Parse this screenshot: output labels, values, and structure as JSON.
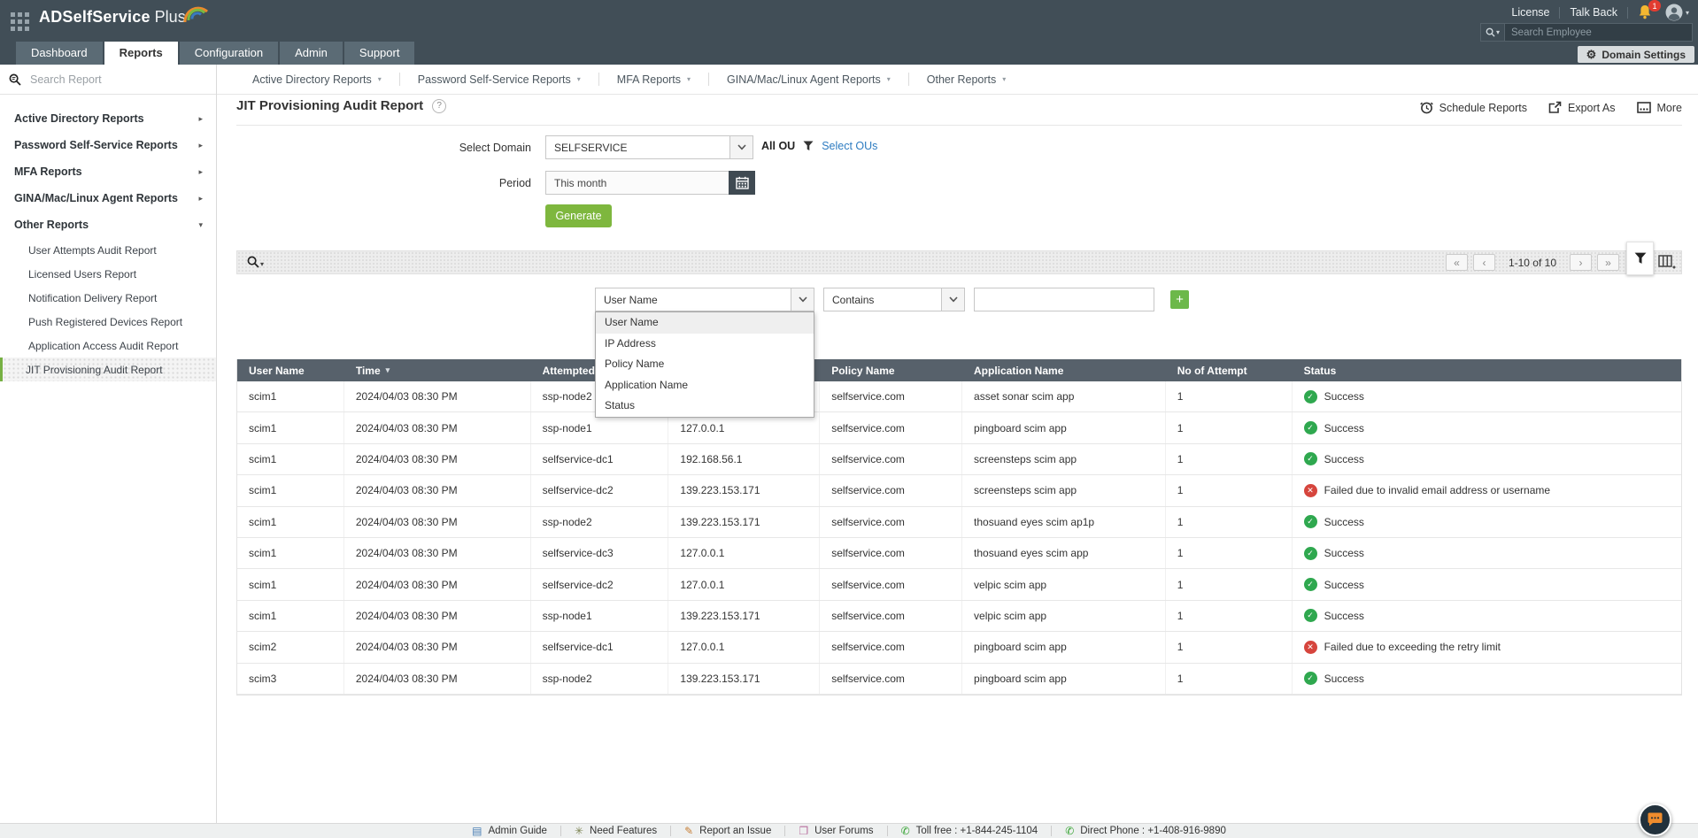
{
  "header": {
    "brand": {
      "name_bold": "ADSelfService",
      "name_light": "Plus"
    },
    "utilities": {
      "license": "License",
      "talk_back": "Talk Back",
      "notification_count": "1"
    },
    "employee_search_placeholder": "Search Employee",
    "domain_settings_label": "Domain Settings",
    "tabs": [
      {
        "label": "Dashboard",
        "active": false
      },
      {
        "label": "Reports",
        "active": true
      },
      {
        "label": "Configuration",
        "active": false
      },
      {
        "label": "Admin",
        "active": false
      },
      {
        "label": "Support",
        "active": false
      }
    ]
  },
  "reports_nav": {
    "items": [
      "Active Directory Reports",
      "Password Self-Service Reports",
      "MFA Reports",
      "GINA/Mac/Linux Agent Reports",
      "Other Reports"
    ]
  },
  "sidebar": {
    "search_placeholder": "Search Report",
    "top_items": [
      {
        "label": "Active Directory Reports",
        "expanded": false
      },
      {
        "label": "Password Self-Service Reports",
        "expanded": false
      },
      {
        "label": "MFA Reports",
        "expanded": false
      },
      {
        "label": "GINA/Mac/Linux Agent Reports",
        "expanded": false
      },
      {
        "label": "Other Reports",
        "expanded": true
      }
    ],
    "other_reports_items": [
      "User Attempts Audit Report",
      "Licensed Users Report",
      "Notification Delivery Report",
      "Push Registered Devices Report",
      "Application Access Audit Report",
      "JIT Provisioning Audit Report"
    ],
    "selected_item": "JIT Provisioning Audit Report"
  },
  "page": {
    "title": "JIT Provisioning Audit Report",
    "actions": {
      "schedule": "Schedule Reports",
      "export": "Export As",
      "more": "More"
    },
    "form": {
      "select_domain_label": "Select Domain",
      "domain_value": "SELFSERVICE",
      "all_ou_label": "All OU",
      "select_ous_label": "Select OUs",
      "period_label": "Period",
      "period_value": "This month",
      "generate_label": "Generate"
    },
    "toolbar": {
      "pagination_text": "1-10 of 10"
    },
    "filter": {
      "field_value": "User Name",
      "operator_value": "Contains",
      "input_value": "",
      "field_options": [
        "User Name",
        "IP Address",
        "Policy Name",
        "Application Name",
        "Status"
      ]
    },
    "table": {
      "columns": [
        "User Name",
        "Time",
        "Attempted",
        "",
        "Policy Name",
        "Application Name",
        "No of Attempt",
        "Status"
      ],
      "sort_column": "Time",
      "rows": [
        {
          "user_name": "scim1",
          "time": "2024/04/03 08:30 PM",
          "attempted_node": "ssp-node2",
          "ip_address": "",
          "policy_name": "selfservice.com",
          "application_name": "asset sonar scim app",
          "no_of_attempt": "1",
          "status": "Success",
          "status_ok": true
        },
        {
          "user_name": "scim1",
          "time": "2024/04/03 08:30 PM",
          "attempted_node": "ssp-node1",
          "ip_address": "127.0.0.1",
          "policy_name": "selfservice.com",
          "application_name": "pingboard scim app",
          "no_of_attempt": "1",
          "status": "Success",
          "status_ok": true
        },
        {
          "user_name": "scim1",
          "time": "2024/04/03 08:30 PM",
          "attempted_node": "selfservice-dc1",
          "ip_address": "192.168.56.1",
          "policy_name": "selfservice.com",
          "application_name": "screensteps scim app",
          "no_of_attempt": "1",
          "status": "Success",
          "status_ok": true
        },
        {
          "user_name": "scim1",
          "time": "2024/04/03 08:30 PM",
          "attempted_node": "selfservice-dc2",
          "ip_address": "139.223.153.171",
          "policy_name": "selfservice.com",
          "application_name": "screensteps scim app",
          "no_of_attempt": "1",
          "status": "Failed due to invalid email address or username",
          "status_ok": false
        },
        {
          "user_name": "scim1",
          "time": "2024/04/03 08:30 PM",
          "attempted_node": "ssp-node2",
          "ip_address": "139.223.153.171",
          "policy_name": "selfservice.com",
          "application_name": "thosuand eyes scim ap1p",
          "no_of_attempt": "1",
          "status": "Success",
          "status_ok": true
        },
        {
          "user_name": "scim1",
          "time": "2024/04/03 08:30 PM",
          "attempted_node": "selfservice-dc3",
          "ip_address": "127.0.0.1",
          "policy_name": "selfservice.com",
          "application_name": "thosuand eyes scim app",
          "no_of_attempt": "1",
          "status": "Success",
          "status_ok": true
        },
        {
          "user_name": "scim1",
          "time": "2024/04/03 08:30 PM",
          "attempted_node": "selfservice-dc2",
          "ip_address": "127.0.0.1",
          "policy_name": "selfservice.com",
          "application_name": "velpic scim app",
          "no_of_attempt": "1",
          "status": "Success",
          "status_ok": true
        },
        {
          "user_name": "scim1",
          "time": "2024/04/03 08:30 PM",
          "attempted_node": "ssp-node1",
          "ip_address": "139.223.153.171",
          "policy_name": "selfservice.com",
          "application_name": "velpic scim app",
          "no_of_attempt": "1",
          "status": "Success",
          "status_ok": true
        },
        {
          "user_name": "scim2",
          "time": "2024/04/03 08:30 PM",
          "attempted_node": "selfservice-dc1",
          "ip_address": "127.0.0.1",
          "policy_name": "selfservice.com",
          "application_name": "pingboard scim app",
          "no_of_attempt": "1",
          "status": "Failed due to exceeding the retry limit",
          "status_ok": false
        },
        {
          "user_name": "scim3",
          "time": "2024/04/03 08:30 PM",
          "attempted_node": "ssp-node2",
          "ip_address": "139.223.153.171",
          "policy_name": "selfservice.com",
          "application_name": "pingboard scim app",
          "no_of_attempt": "1",
          "status": "Success",
          "status_ok": true
        }
      ]
    }
  },
  "footer": {
    "items": [
      {
        "icon": "book",
        "label": "Admin Guide"
      },
      {
        "icon": "features",
        "label": "Need Features"
      },
      {
        "icon": "report",
        "label": "Report an Issue"
      },
      {
        "icon": "forums",
        "label": "User Forums"
      },
      {
        "icon": "phone",
        "label": "Toll free : +1-844-245-1104"
      },
      {
        "icon": "phone",
        "label": "Direct Phone : +1-408-916-9890"
      }
    ]
  },
  "colors": {
    "header_bg": "#414e57",
    "accent_green": "#7eb73e",
    "link_blue": "#2e7cc1",
    "table_header_bg": "#57616b",
    "success_green": "#2fa84f",
    "fail_red": "#d6453d",
    "badge_red": "#e23c30"
  }
}
